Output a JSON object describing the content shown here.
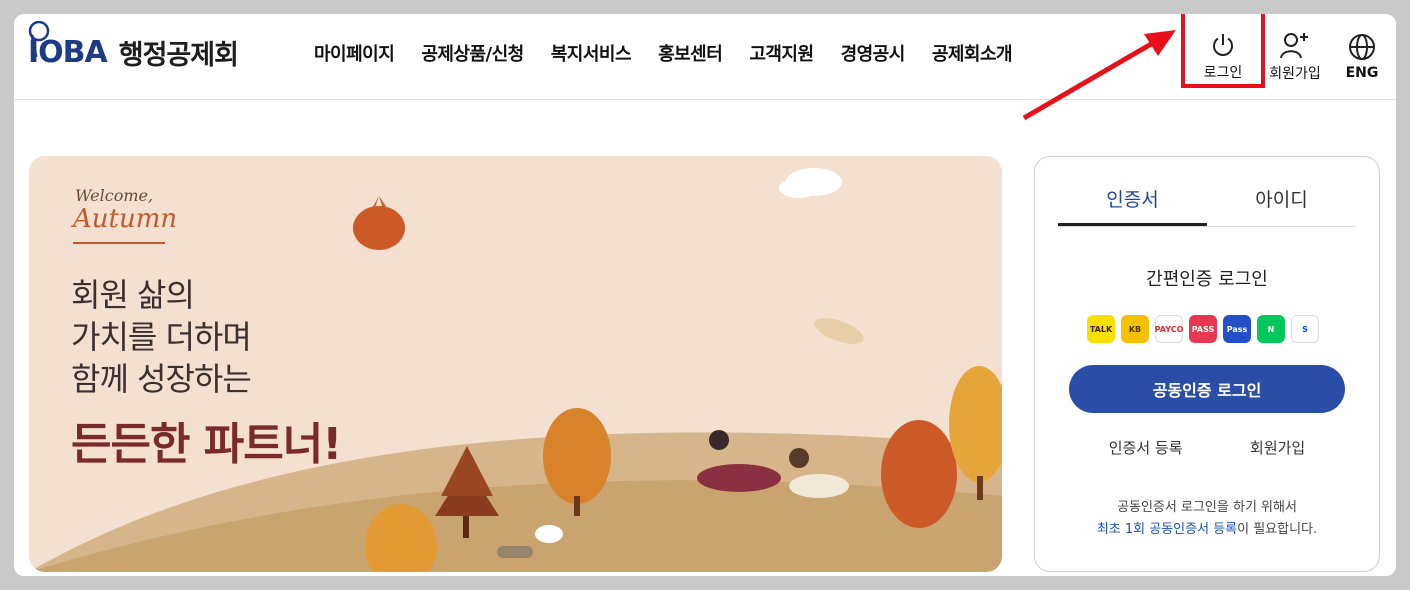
{
  "header": {
    "logo_mark": "IOBA",
    "logo_name": "행정공제회",
    "nav": [
      "마이페이지",
      "공제상품/신청",
      "복지서비스",
      "홍보센터",
      "고객지원",
      "경영공시",
      "공제회소개"
    ],
    "login_label": "로그인",
    "join_label": "회원가입",
    "eng_label": "ENG"
  },
  "banner": {
    "welcome": "Welcome,",
    "autumn": "Autumn",
    "lines": [
      "회원 삶의",
      "가치를 더하며",
      "함께 성장하는"
    ],
    "bold": "든든한 파트너!"
  },
  "login_panel": {
    "tabs": [
      "인증서",
      "아이디"
    ],
    "active_tab": "인증서",
    "easy_title": "간편인증 로그인",
    "providers": [
      {
        "name": "TALK",
        "color": "#f9e000",
        "text_color": "#3a1d1d"
      },
      {
        "name": "KB",
        "color": "#f5c000",
        "text_color": "#4a3a00"
      },
      {
        "name": "PAYCO",
        "color": "#ffffff",
        "text_color": "#e8262b"
      },
      {
        "name": "PASS",
        "color": "#e8384f",
        "text_color": "#ffffff"
      },
      {
        "name": "Pass",
        "color": "#2350c8",
        "text_color": "#ffffff"
      },
      {
        "name": "N",
        "color": "#03c75a",
        "text_color": "#ffffff"
      },
      {
        "name": "S",
        "color": "#ffffff",
        "text_color": "#0046ff"
      }
    ],
    "cert_button": "공동인증 로그인",
    "link_register": "인증서 등록",
    "link_join": "회원가입",
    "notice_line1": "공동인증서 로그인을 하기 위해서",
    "notice_hl": "최초 1회 공동인증서 등록",
    "notice_tail": "이 필요합니다."
  },
  "colors": {
    "accent": "#2a4ea8",
    "highlight_box": "#e8101a",
    "banner_bg": "#f3e0d0"
  }
}
